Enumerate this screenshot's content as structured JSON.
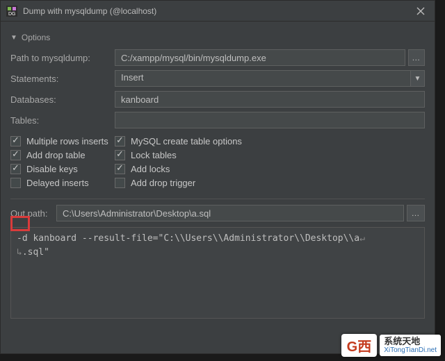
{
  "titlebar": {
    "title": "Dump with mysqldump (@localhost)"
  },
  "options": {
    "header": "Options",
    "path_label": "Path to mysqldump:",
    "path_value": "C:/xampp/mysql/bin/mysqldump.exe",
    "statements_label": "Statements:",
    "statements_value": "Insert",
    "databases_label": "Databases:",
    "databases_value": "kanboard",
    "tables_label": "Tables:",
    "tables_value": ""
  },
  "checks": {
    "multiple_rows": "Multiple rows inserts",
    "add_drop_table": "Add drop table",
    "disable_keys": "Disable keys",
    "delayed_inserts": "Delayed inserts",
    "mysql_create_table": "MySQL create table options",
    "lock_tables": "Lock tables",
    "add_locks": "Add locks",
    "add_drop_trigger": "Add drop trigger"
  },
  "outpath": {
    "label": "Out path:",
    "value": "C:\\Users\\Administrator\\Desktop\\a.sql"
  },
  "cmd": {
    "line1": "-d kanboard --result-file=\"C:\\\\Users\\\\Administrator\\\\Desktop\\\\a",
    "line2": ".sql\""
  },
  "watermark": {
    "badge": "G西",
    "line1": "系统天地",
    "line2": "XiTongTianDi.net"
  }
}
